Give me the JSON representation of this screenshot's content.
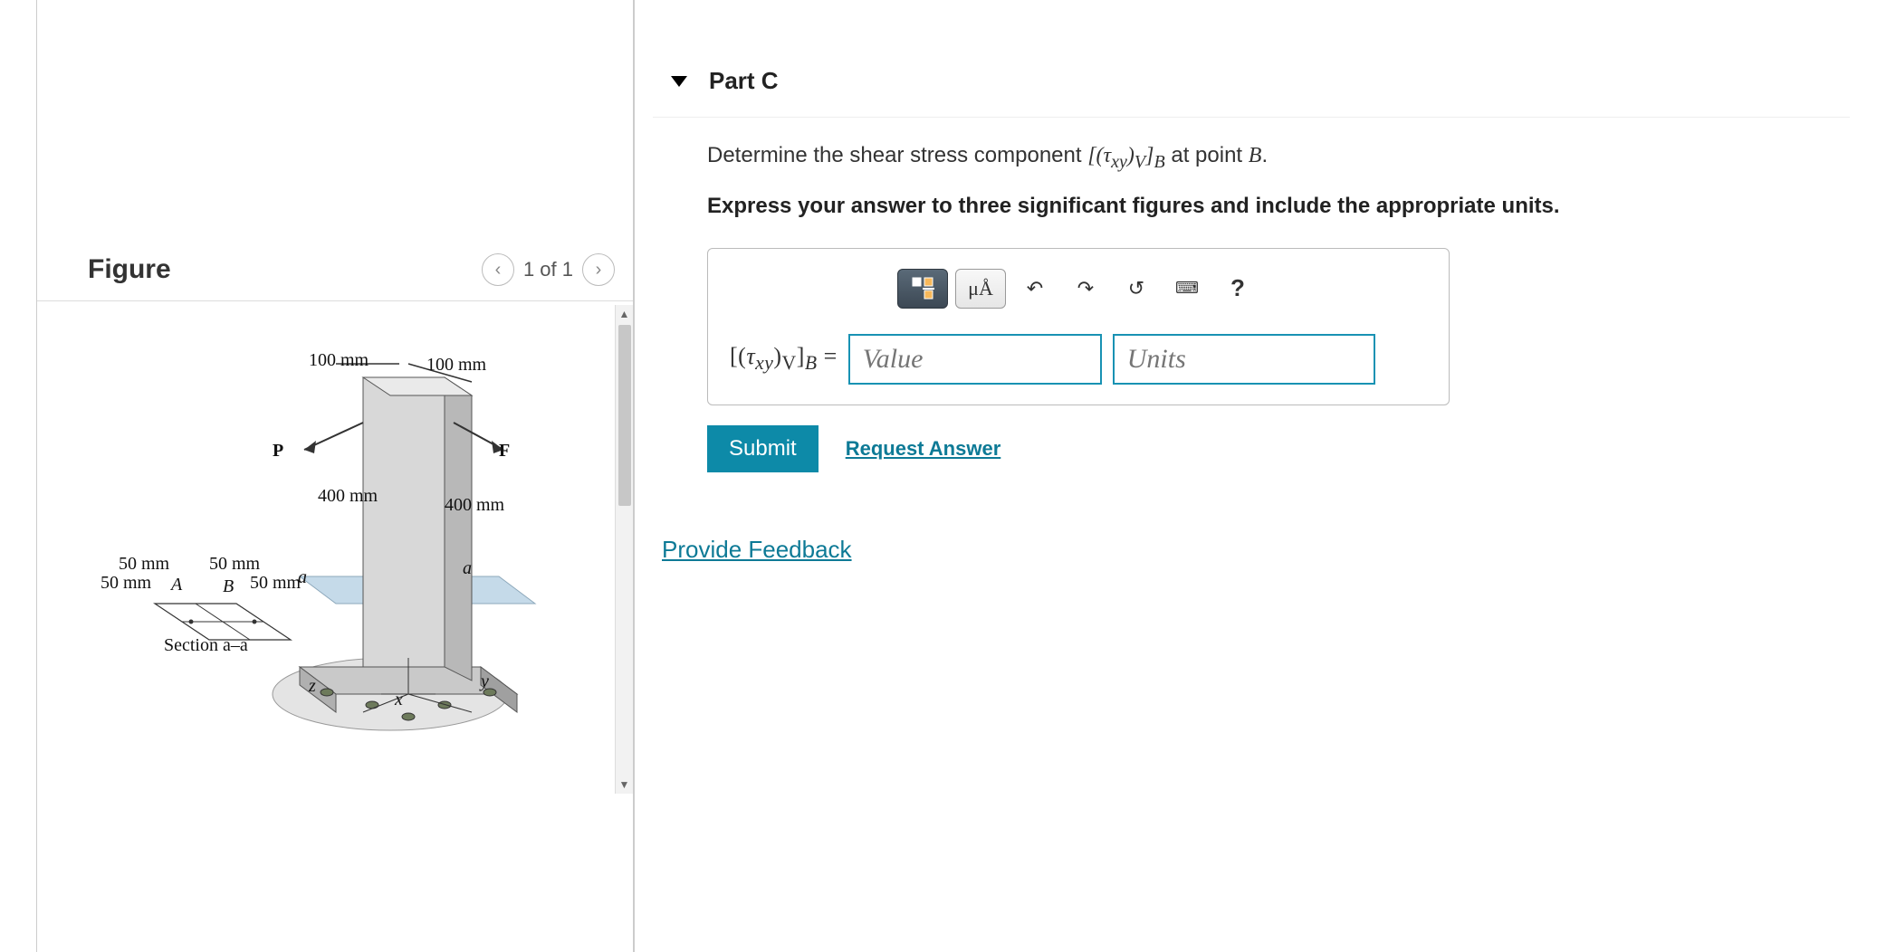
{
  "figure": {
    "title": "Figure",
    "nav": "1 of 1",
    "labels": {
      "top_left": "100 mm",
      "top_right": "100 mm",
      "load_p": "P",
      "load_f": "F",
      "height_left": "400 mm",
      "height_right": "400 mm",
      "section_a_left": "a",
      "section_a_right": "a",
      "axis_x": "x",
      "axis_y": "y",
      "axis_z": "z",
      "cs_tl": "50 mm",
      "cs_tr": "50 mm",
      "cs_bl": "50 mm",
      "cs_br": "50 mm",
      "cs_a": "A",
      "cs_b": "B",
      "section_label": "Section a–a"
    }
  },
  "part": {
    "label": "Part C",
    "prompt_prefix": "Determine the shear stress component ",
    "prompt_var_html": "[(τ_xy)_V]_B",
    "prompt_mid": " at point ",
    "prompt_point": "B",
    "prompt_suffix": ".",
    "instruction": "Express your answer to three significant figures and include the appropriate units.",
    "toolbar": {
      "fraction": "▯/▯",
      "units_special": "μÅ",
      "undo": "↶",
      "redo": "↷",
      "reset": "↺",
      "keyboard": "⌨",
      "help": "?"
    },
    "answer_label": "[(τ_xy)_V]_B =",
    "value_placeholder": "Value",
    "units_placeholder": "Units",
    "submit": "Submit",
    "request": "Request Answer"
  },
  "feedback": "Provide Feedback"
}
